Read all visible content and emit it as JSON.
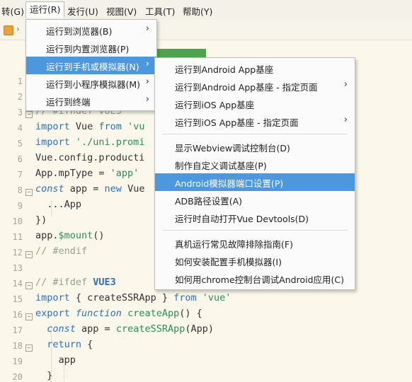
{
  "menubar": {
    "items": [
      {
        "label": "转(G)"
      },
      {
        "label": "运行(R)"
      },
      {
        "label": "发行(U)"
      },
      {
        "label": "视图(V)"
      },
      {
        "label": "工具(T)"
      },
      {
        "label": "帮助(Y)"
      }
    ]
  },
  "run_menu": {
    "items": [
      {
        "label": "运行到浏览器(B)",
        "submenu": true
      },
      {
        "label": "运行到内置浏览器(P)",
        "submenu": false
      },
      {
        "label": "运行到手机或模拟器(N)",
        "submenu": true,
        "highlighted": true
      },
      {
        "label": "运行到小程序模拟器(M)",
        "submenu": true
      },
      {
        "label": "运行到终端",
        "submenu": true
      }
    ]
  },
  "device_menu": {
    "items": [
      {
        "label": "运行到Android App基座"
      },
      {
        "label": "运行到Android App基座 - 指定页面",
        "submenu": true
      },
      {
        "label": "运行到iOS App基座"
      },
      {
        "label": "运行到iOS App基座 - 指定页面",
        "submenu": true
      },
      {
        "label": "显示Webview调试控制台(D)"
      },
      {
        "label": "制作自定义调试基座(P)"
      },
      {
        "label": "Android模拟器端口设置(P)",
        "highlighted": true
      },
      {
        "label": "ADB路径设置(A)"
      },
      {
        "label": "运行时自动打开Vue Devtools(D)"
      },
      {
        "label": "真机运行常见故障排除指南(F)"
      },
      {
        "label": "如何安装配置手机模拟器(I)"
      },
      {
        "label": "如何用chrome控制台调试Android应用(C)"
      }
    ]
  },
  "editor": {
    "line_numbers": [
      "1",
      "2",
      "3",
      "4",
      "5",
      "6",
      "7",
      "8",
      "9",
      "10",
      "11",
      "12",
      "13",
      "14",
      "15",
      "16",
      "17",
      "18",
      "19",
      "20"
    ],
    "lines": {
      "l3": "// #ifndef VUE3",
      "l4a": "import",
      "l4b": " Vue ",
      "l4c": "from",
      "l4d": " 'vu",
      "l5a": "import",
      "l5b": " './uni.promi",
      "l6": "Vue.config.producti",
      "l7a": "App.mpType = ",
      "l7b": "'app'",
      "l8a": "const",
      "l8b": " app = ",
      "l8c": "new",
      "l8d": " Vue",
      "l9": "  ...App",
      "l10": "})",
      "l11a": "app.",
      "l11b": "$mount",
      "l11c": "()",
      "l12": "// #endif",
      "l14a": "// #ifdef ",
      "l14b": "VUE3",
      "l15a": "import",
      "l15b": " { createSSRApp } ",
      "l15c": "from",
      "l15d": " 'vue'",
      "l16a": "export",
      "l16b": " function",
      "l16c": " createApp",
      "l16d": "() {",
      "l17a": "  const",
      "l17b": " app = ",
      "l17c": "createSSRApp",
      "l17d": "(App)",
      "l18a": "  return",
      "l18b": " {",
      "l19": "    app",
      "l20": "  }"
    }
  },
  "colors": {
    "highlight": "#4d97df",
    "keyword": "#2f6fc2",
    "string": "#2e8d57",
    "comment": "#9aa08f"
  }
}
